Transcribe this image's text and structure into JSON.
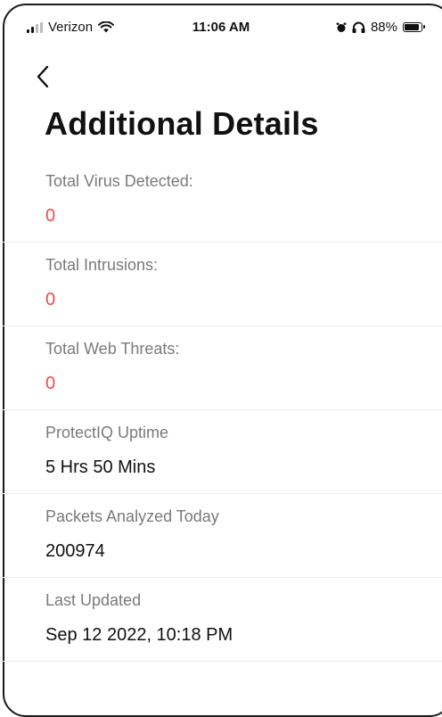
{
  "status_bar": {
    "carrier": "Verizon",
    "time": "11:06 AM",
    "battery": "88%",
    "battery_level": 0.88
  },
  "page": {
    "title": "Additional Details"
  },
  "details": [
    {
      "label": "Total Virus Detected:",
      "value": "0",
      "alert": true
    },
    {
      "label": "Total Intrusions:",
      "value": "0",
      "alert": true
    },
    {
      "label": "Total Web Threats:",
      "value": "0",
      "alert": true
    },
    {
      "label": "ProtectIQ Uptime",
      "value": "5 Hrs 50 Mins",
      "alert": false
    },
    {
      "label": "Packets Analyzed Today",
      "value": "200974",
      "alert": false
    },
    {
      "label": "Last Updated",
      "value": "Sep 12 2022, 10:18 PM",
      "alert": false
    }
  ],
  "colors": {
    "alert_value": "#f04b4b",
    "label": "#7a7a7a",
    "text": "#111111"
  },
  "icons": {
    "back": "chevron-left-icon",
    "wifi": "wifi-icon",
    "alarm": "alarm-icon",
    "headphones": "headphones-icon"
  }
}
